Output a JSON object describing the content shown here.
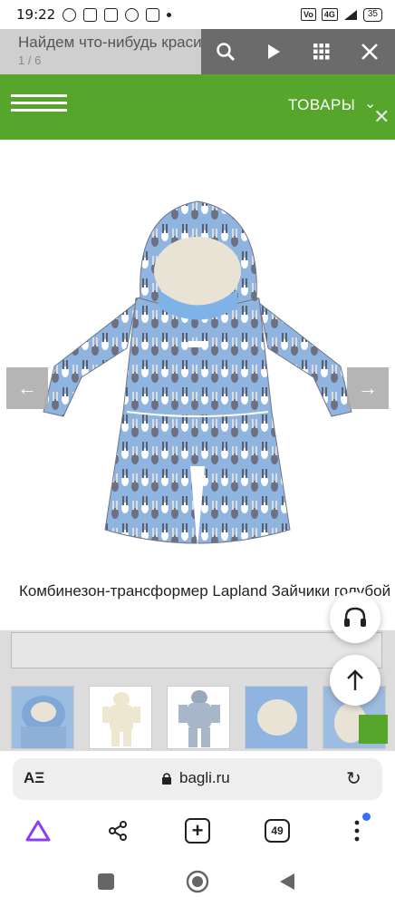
{
  "status_bar": {
    "time": "19:22",
    "network": "4G",
    "battery": "35"
  },
  "search": {
    "placeholder": "Найдем что-нибудь красивое?..",
    "counter": "1 / 6"
  },
  "header": {
    "menu_label": "ТОВАРЫ"
  },
  "product": {
    "title": "Комбинезон-трансформер Lapland Зайчики голубой"
  },
  "browser": {
    "domain": "bagli.ru",
    "reader_icon": "AΞ",
    "tabs_count": "49"
  },
  "colors": {
    "brand_green": "#55a62a",
    "tab_badge_blue": "#3b6ef5"
  },
  "icons": [
    "search-icon",
    "play-icon",
    "grid-icon",
    "close-icon",
    "menu-icon",
    "chevron-down-icon",
    "arrow-left-icon",
    "arrow-right-icon",
    "headphones-icon",
    "arrow-up-icon",
    "lock-icon",
    "reload-icon",
    "alice-icon",
    "share-icon",
    "new-tab-icon",
    "tabs-icon",
    "more-icon",
    "recents-icon",
    "home-icon",
    "back-icon"
  ]
}
